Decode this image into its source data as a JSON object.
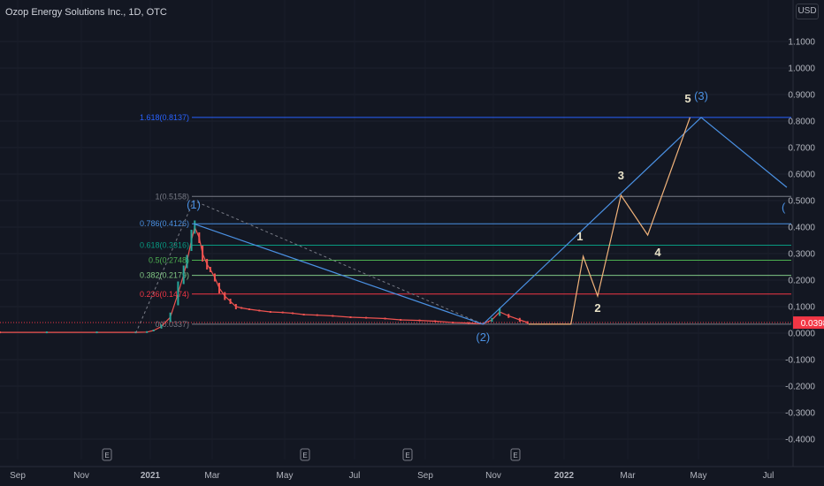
{
  "header": {
    "title": "Ozop Energy Solutions Inc., 1D, OTC",
    "currency": "USD"
  },
  "price_label": {
    "value": "0.0398",
    "color": "#f23645"
  },
  "colors": {
    "background": "#131722",
    "axis_text": "#b2b5be",
    "candle_up": "#26a69a",
    "candle_down": "#ef5350",
    "wave_blue": "#4a90e2",
    "wave_orange": "#f0b27a",
    "wave_label_white": "#e8e2c8",
    "wave_label_blue": "#4a90e2"
  },
  "chart_data": {
    "type": "line",
    "title": "Ozop Energy Solutions Inc., 1D, OTC",
    "xlabel": "",
    "ylabel": "",
    "ylim": [
      -0.4,
      1.1
    ],
    "x_ticks": [
      "Sep",
      "Nov",
      "2021",
      "Mar",
      "May",
      "Jul",
      "Sep",
      "Nov",
      "2022",
      "Mar",
      "May",
      "Jul"
    ],
    "y_ticks": [
      "1.1000",
      "1.0000",
      "0.9000",
      "0.8000",
      "0.7000",
      "0.6000",
      "0.5000",
      "0.4000",
      "0.3000",
      "0.2000",
      "0.1000",
      "0.0000",
      "-0.1000",
      "-0.2000",
      "-0.3000",
      "-0.4000"
    ],
    "earnings_markers": [
      "E",
      "E",
      "E",
      "E"
    ],
    "series": [
      {
        "name": "",
        "x": [
          "2020-08-20",
          "2020-10-01",
          "2020-11-15",
          "2020-12-20",
          "2020-12-30",
          "2021-01-05",
          "2021-01-12",
          "2021-01-20",
          "2021-01-27",
          "2021-02-01",
          "2021-02-04",
          "2021-02-08",
          "2021-02-11",
          "2021-02-15",
          "2021-02-18",
          "2021-02-22",
          "2021-02-25",
          "2021-03-01",
          "2021-03-05",
          "2021-03-10",
          "2021-03-15",
          "2021-03-20",
          "2021-03-25",
          "2021-04-01",
          "2021-04-10",
          "2021-04-20",
          "2021-05-01",
          "2021-05-10",
          "2021-05-20",
          "2021-06-01",
          "2021-06-15",
          "2021-07-01",
          "2021-07-15",
          "2021-08-01",
          "2021-08-15",
          "2021-09-01",
          "2021-09-15",
          "2021-10-01",
          "2021-10-15",
          "2021-10-28",
          "2021-11-05",
          "2021-11-12",
          "2021-11-20",
          "2021-11-30",
          "2021-12-07"
        ],
        "values": [
          0.003,
          0.003,
          0.003,
          0.003,
          0.004,
          0.01,
          0.025,
          0.06,
          0.15,
          0.22,
          0.27,
          0.35,
          0.4,
          0.36,
          0.3,
          0.26,
          0.24,
          0.21,
          0.17,
          0.14,
          0.12,
          0.1,
          0.095,
          0.09,
          0.085,
          0.08,
          0.078,
          0.075,
          0.07,
          0.068,
          0.065,
          0.06,
          0.058,
          0.055,
          0.05,
          0.048,
          0.045,
          0.04,
          0.038,
          0.035,
          0.05,
          0.08,
          0.065,
          0.05,
          0.04
        ]
      }
    ],
    "fib_levels": [
      {
        "label": "1.618(0.8137)",
        "value": 0.8137,
        "color": "#2962ff"
      },
      {
        "label": "1(0.5158)",
        "value": 0.5158,
        "color": "#787b86"
      },
      {
        "label": "0.786(0.4126)",
        "value": 0.4126,
        "color": "#4a90e2"
      },
      {
        "label": "0.618(0.3316)",
        "value": 0.3316,
        "color": "#089981"
      },
      {
        "label": "0.5(0.2748)",
        "value": 0.2748,
        "color": "#4caf50"
      },
      {
        "label": "0.382(0.2179)",
        "value": 0.2179,
        "color": "#81c784"
      },
      {
        "label": "0.236(0.1474)",
        "value": 0.1474,
        "color": "#f23645"
      },
      {
        "label": "0(0.0337)",
        "value": 0.0337,
        "color": "#787b86"
      }
    ],
    "wave_labels": [
      {
        "text": "(1)",
        "color": "#4a90e2",
        "x": "2021-02-10",
        "y": 0.47
      },
      {
        "text": "(2)",
        "color": "#4a90e2",
        "x": "2021-10-28",
        "y": -0.03
      },
      {
        "text": "(3)",
        "color": "#4a90e2",
        "x": "2022-05-12",
        "y": 0.88
      },
      {
        "text": "1",
        "color": "#e8e2c8",
        "x": "2022-01-23",
        "y": 0.35
      },
      {
        "text": "2",
        "color": "#e8e2c8",
        "x": "2022-02-08",
        "y": 0.08
      },
      {
        "text": "3",
        "color": "#e8e2c8",
        "x": "2022-03-01",
        "y": 0.58
      },
      {
        "text": "4",
        "color": "#e8e2c8",
        "x": "2022-04-03",
        "y": 0.29
      },
      {
        "text": "5",
        "color": "#e8e2c8",
        "x": "2022-04-30",
        "y": 0.87
      },
      {
        "text": "(",
        "color": "#4a90e2",
        "x": "2022-07-25",
        "y": 0.46
      }
    ],
    "blue_wave_path": {
      "x": [
        "2021-02-10",
        "2021-10-28",
        "2022-05-12",
        "2022-07-28"
      ],
      "values": [
        0.4126,
        0.0337,
        0.8137,
        0.55
      ]
    },
    "orange_wave_path": {
      "x": [
        "2021-12-08",
        "2022-01-15",
        "2022-01-26",
        "2022-02-08",
        "2022-03-01",
        "2022-03-25",
        "2022-05-02"
      ],
      "values": [
        0.0337,
        0.0337,
        0.29,
        0.14,
        0.52,
        0.37,
        0.8137
      ]
    },
    "dashed_path": {
      "x": [
        "2020-12-20",
        "2021-02-10",
        "2021-10-28"
      ],
      "values": [
        0.0,
        0.5,
        0.0337
      ]
    }
  }
}
